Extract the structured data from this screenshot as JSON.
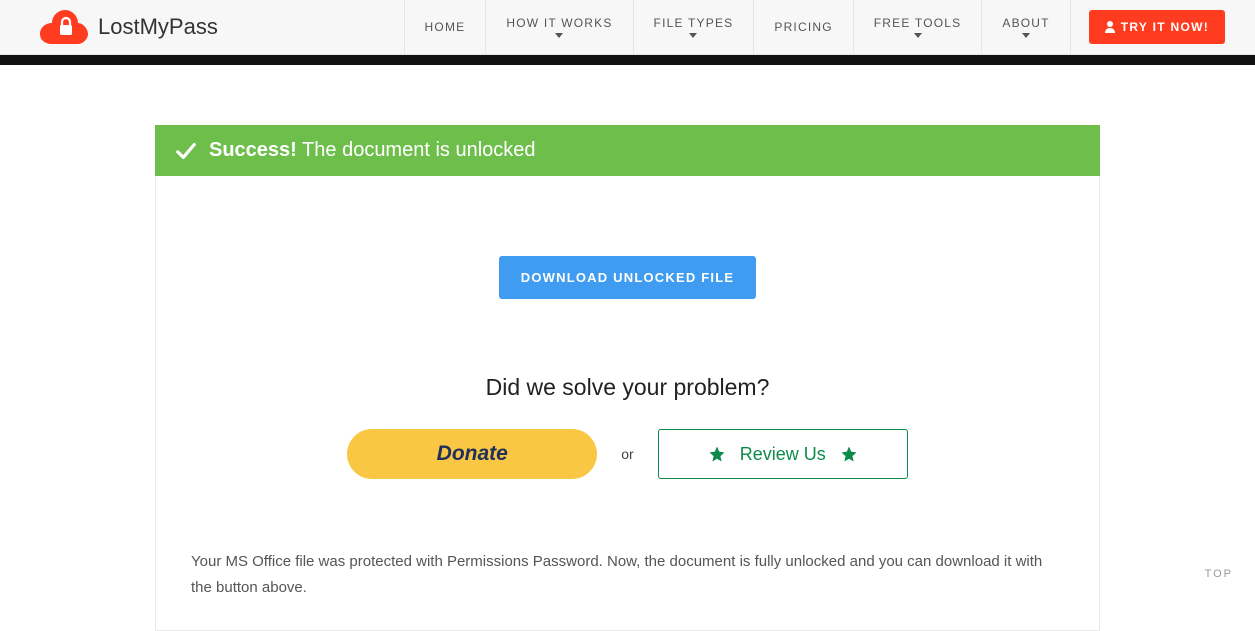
{
  "header": {
    "brand": "LostMyPass",
    "nav": [
      {
        "label": "HOME",
        "caret": false
      },
      {
        "label": "HOW IT WORKS",
        "caret": true
      },
      {
        "label": "FILE TYPES",
        "caret": true
      },
      {
        "label": "PRICING",
        "caret": false
      },
      {
        "label": "FREE TOOLS",
        "caret": true
      },
      {
        "label": "ABOUT",
        "caret": true
      }
    ],
    "cta": "TRY IT NOW!"
  },
  "alert": {
    "strong": "Success!",
    "rest": "The document is unlocked"
  },
  "download_label": "DOWNLOAD UNLOCKED FILE",
  "question": "Did we solve your problem?",
  "donate_label": "Donate",
  "or_label": "or",
  "review_label": "Review Us",
  "explain": "Your MS Office file was protected with Permissions Password. Now, the document is fully unlocked and you can download it with the button above.",
  "to_top": "TOP",
  "colors": {
    "accent_red": "#ff3c1f",
    "alert_green": "#6ebe4c",
    "blue": "#3f9cf0",
    "donate_yellow": "#f9c744",
    "review_green": "#0b8a4a"
  }
}
